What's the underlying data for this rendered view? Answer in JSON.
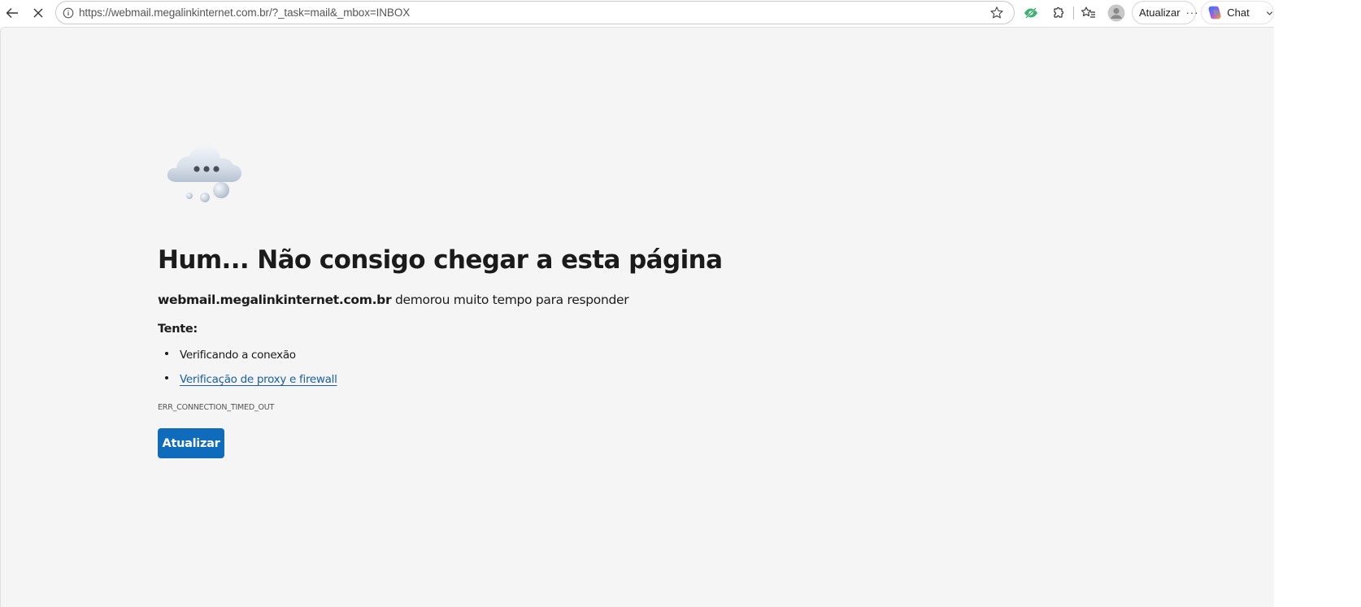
{
  "browser": {
    "url": "https://webmail.megalinkinternet.com.br/?_task=mail&_mbox=INBOX",
    "update_label": "Atualizar",
    "chat_label": "Chat"
  },
  "error_page": {
    "title": "Hum... Não consigo chegar a esta página",
    "host": "webmail.megalinkinternet.com.br",
    "description": " demorou muito tempo para responder",
    "try_label": "Tente:",
    "suggestions": [
      "Verificando a conexão",
      "Verificação de proxy e firewall"
    ],
    "error_code": "ERR_CONNECTION_TIMED_OUT",
    "reload_button": "Atualizar"
  },
  "colors": {
    "page_background": "#f5f5f5",
    "button_blue": "#0f6cbd",
    "link_blue": "#1a5fa8"
  }
}
